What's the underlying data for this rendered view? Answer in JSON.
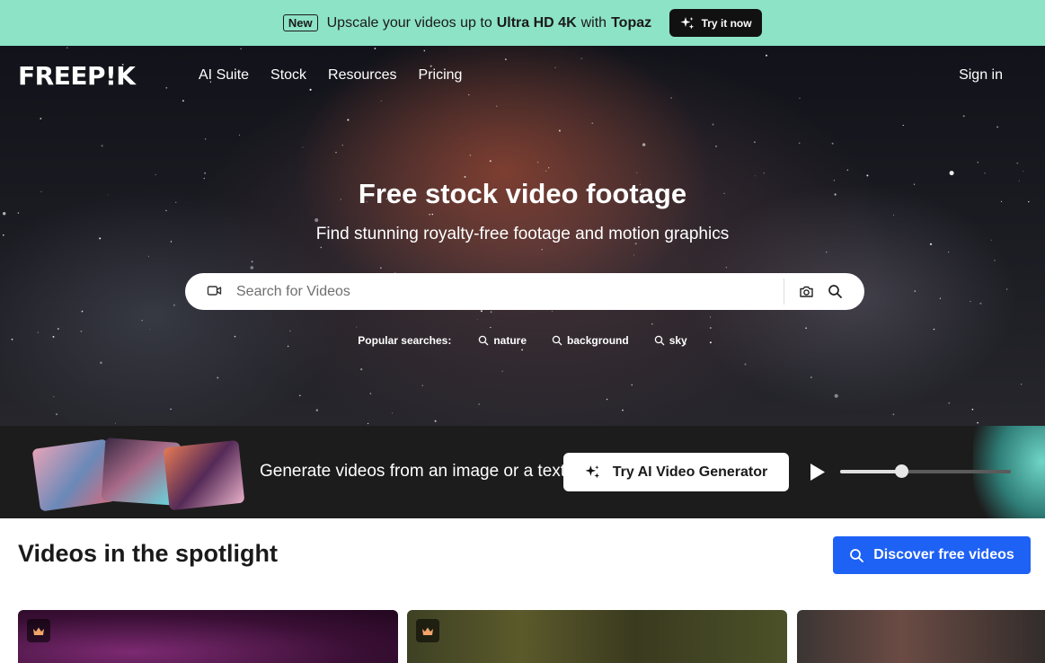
{
  "promo": {
    "badge": "New",
    "text_1": "Upscale your videos up to",
    "text_bold_1": "Ultra HD 4K",
    "text_2": "with",
    "text_bold_2": "Topaz",
    "button": "Try it now",
    "background_color": "#8de3c6"
  },
  "nav": {
    "logo": "FREEP!K",
    "items": [
      "AI Suite",
      "Stock",
      "Resources",
      "Pricing"
    ],
    "sign_in": "Sign in"
  },
  "hero": {
    "title": "Free stock video footage",
    "subtitle": "Find stunning royalty-free footage and motion graphics",
    "search_placeholder": "Search for Videos",
    "popular_label": "Popular searches:",
    "popular": [
      "nature",
      "background",
      "sky"
    ]
  },
  "ai_strip": {
    "text": "Generate videos from an image or a text",
    "button": "Try AI Video Generator",
    "progress": 0.36
  },
  "spotlight": {
    "title": "Videos in the spotlight",
    "discover_button": "Discover free videos",
    "accent_color": "#1e61f5"
  }
}
